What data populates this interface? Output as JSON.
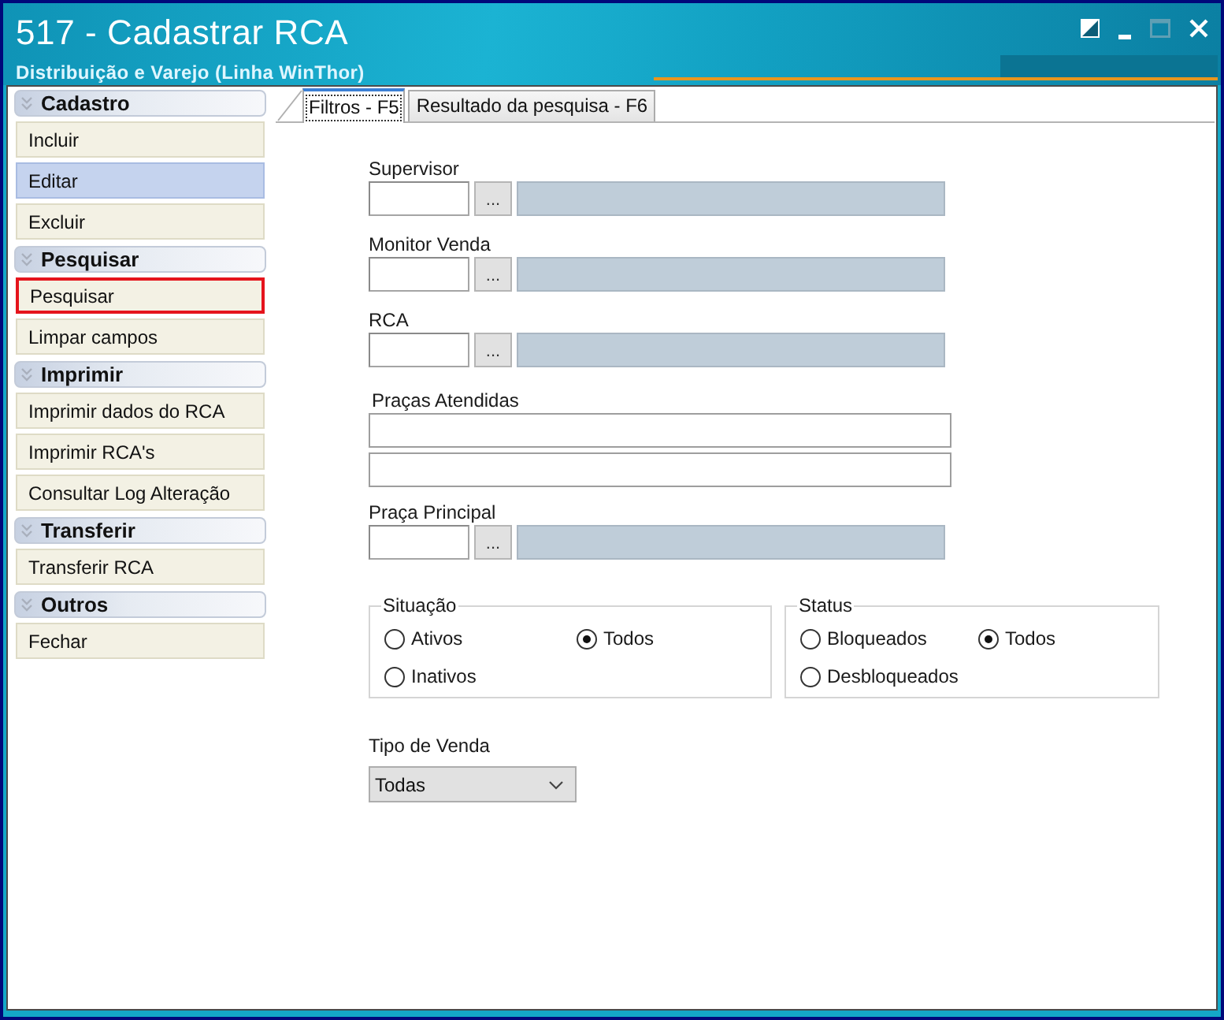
{
  "window": {
    "title": "517 - Cadastrar RCA",
    "subtitle": "Distribuição e Varejo (Linha WinThor)",
    "maximize_disabled": true
  },
  "sidebar": {
    "groups": [
      {
        "title": "Cadastro",
        "items": [
          {
            "label": "Incluir",
            "selected": false,
            "highlighted": false
          },
          {
            "label": "Editar",
            "selected": true,
            "highlighted": false
          },
          {
            "label": "Excluir",
            "selected": false,
            "highlighted": false
          }
        ]
      },
      {
        "title": "Pesquisar",
        "items": [
          {
            "label": "Pesquisar",
            "selected": false,
            "highlighted": true
          },
          {
            "label": "Limpar campos",
            "selected": false,
            "highlighted": false
          }
        ]
      },
      {
        "title": "Imprimir",
        "items": [
          {
            "label": "Imprimir dados do RCA",
            "selected": false,
            "highlighted": false
          },
          {
            "label": "Imprimir RCA's",
            "selected": false,
            "highlighted": false
          },
          {
            "label": "Consultar Log Alteração",
            "selected": false,
            "highlighted": false
          }
        ]
      },
      {
        "title": "Transferir",
        "items": [
          {
            "label": "Transferir RCA",
            "selected": false,
            "highlighted": false
          }
        ]
      },
      {
        "title": "Outros",
        "items": [
          {
            "label": "Fechar",
            "selected": false,
            "highlighted": false
          }
        ]
      }
    ]
  },
  "tabs": [
    {
      "label": "Filtros - F5",
      "selected": true
    },
    {
      "label": "Resultado da pesquisa - F6",
      "selected": false
    }
  ],
  "filters": {
    "fields": [
      {
        "kind": "lookup",
        "label": "Supervisor",
        "button": "..."
      },
      {
        "kind": "lookup",
        "label": "Monitor Venda",
        "button": "..."
      },
      {
        "kind": "lookup",
        "label": "RCA",
        "button": "..."
      },
      {
        "kind": "list",
        "label": "Praças Atendidas"
      },
      {
        "kind": "lookup",
        "label": "Praça Principal",
        "button": "..."
      }
    ],
    "radio_groups": [
      {
        "title": "Situação",
        "options": [
          {
            "label": "Ativos",
            "selected": false
          },
          {
            "label": "Todos",
            "selected": true
          },
          {
            "label": "Inativos",
            "selected": false
          }
        ]
      },
      {
        "title": "Status",
        "options": [
          {
            "label": "Bloqueados",
            "selected": false
          },
          {
            "label": "Todos",
            "selected": true
          },
          {
            "label": "Desbloqueados",
            "selected": false
          }
        ]
      }
    ],
    "sale_type": {
      "label": "Tipo de Venda",
      "value": "Todas"
    }
  }
}
